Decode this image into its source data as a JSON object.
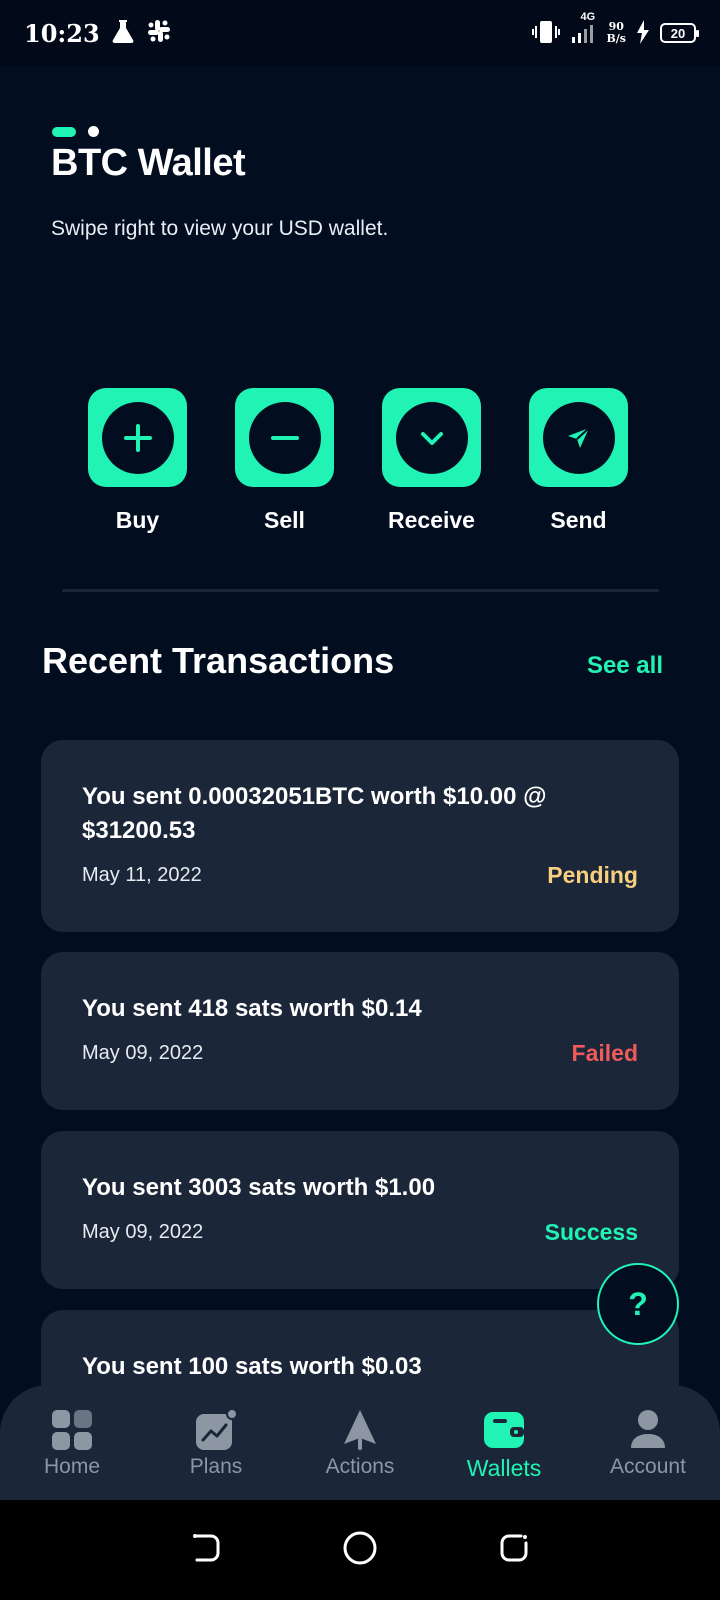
{
  "status_bar": {
    "time": "10:23",
    "network": "4G",
    "speed_top": "90",
    "speed_bottom": "B/s",
    "battery": "20"
  },
  "header": {
    "title": "BTC Wallet",
    "subtitle": "Swipe right to view your USD wallet."
  },
  "actions": [
    {
      "label": "Buy",
      "icon": "plus-icon"
    },
    {
      "label": "Sell",
      "icon": "minus-icon"
    },
    {
      "label": "Receive",
      "icon": "chevron-down-icon"
    },
    {
      "label": "Send",
      "icon": "send-arrow-icon"
    }
  ],
  "transactions_section": {
    "title": "Recent Transactions",
    "see_all": "See all"
  },
  "transactions": [
    {
      "title": "You sent 0.00032051BTC worth $10.00 @ $31200.53",
      "date": "May 11, 2022",
      "status": "Pending",
      "status_color": "#f7cf7e"
    },
    {
      "title": "You sent 418 sats worth $0.14",
      "date": "May 09, 2022",
      "status": "Failed",
      "status_color": "#ef5a5a"
    },
    {
      "title": "You sent 3003 sats worth $1.00",
      "date": "May 09, 2022",
      "status": "Success",
      "status_color": "#20f3b4"
    },
    {
      "title": "You sent 100 sats worth $0.03",
      "date": "",
      "status": "",
      "status_color": "#20f3b4"
    }
  ],
  "help_button": {
    "label": "?"
  },
  "bottom_nav": [
    {
      "label": "Home",
      "icon": "grid-icon",
      "active": false
    },
    {
      "label": "Plans",
      "icon": "chart-icon",
      "active": false
    },
    {
      "label": "Actions",
      "icon": "rocket-icon",
      "active": false
    },
    {
      "label": "Wallets",
      "icon": "wallet-icon",
      "active": true
    },
    {
      "label": "Account",
      "icon": "user-icon",
      "active": false
    }
  ],
  "colors": {
    "accent": "#20f3b4",
    "background": "#020d1f",
    "card": "#1b2638"
  }
}
